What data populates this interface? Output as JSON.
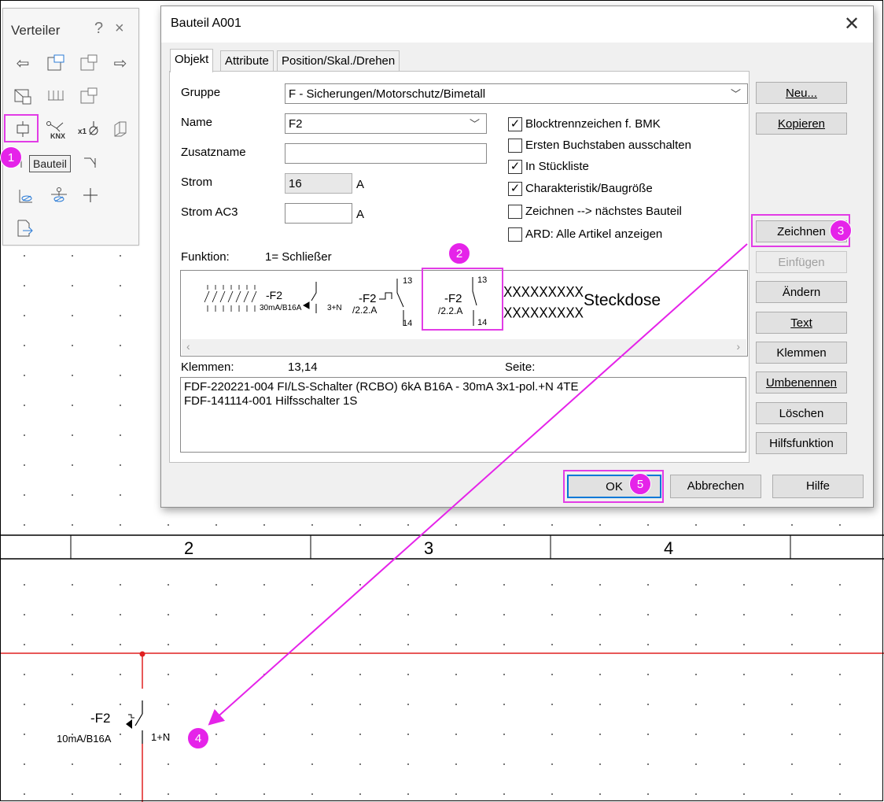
{
  "palette": {
    "title": "Verteiler",
    "help": "?",
    "close": "×",
    "tooltip": "Bauteil",
    "tool_knx_label": "KNX",
    "tool_x1_label": "x1"
  },
  "dialog": {
    "title": "Bauteil A001",
    "tabs": [
      "Objekt",
      "Attribute",
      "Position/Skal./Drehen"
    ],
    "gruppe_label": "Gruppe",
    "gruppe_value": "F - Sicherungen/Motorschutz/Bimetall",
    "name_label": "Name",
    "name_value": "F2",
    "zusatzname_label": "Zusatzname",
    "zusatzname_value": "",
    "strom_label": "Strom",
    "strom_value": "16",
    "strom_unit": "A",
    "stromac3_label": "Strom AC3",
    "stromac3_value": "",
    "stromac3_unit": "A",
    "checkboxes": [
      {
        "label": "Blocktrennzeichen f. BMK",
        "checked": true
      },
      {
        "label": "Ersten Buchstaben ausschalten",
        "checked": false
      },
      {
        "label": "In Stückliste",
        "checked": true
      },
      {
        "label": "Charakteristik/Baugröße",
        "checked": true
      },
      {
        "label": "Zeichnen --> nächstes Bauteil",
        "checked": false
      },
      {
        "label": "ARD: Alle Artikel anzeigen",
        "checked": false
      }
    ],
    "funktion_label": "Funktion:",
    "funktion_value": "1= Schließer",
    "preview": {
      "sym1_label": "-F2",
      "sym1_sub": "30mA/B16A",
      "sym1_pol": "3+N",
      "sym2_label": "-F2",
      "sym2_ref": "/2.2.A",
      "sym2_t1": "13",
      "sym2_t2": "14",
      "sym3_label": "-F2",
      "sym3_ref": "/2.2.A",
      "sym3_t1": "13",
      "sym3_t2": "14",
      "xx1": "XXXXXXXXX",
      "xx2": "XXXXXXXXX",
      "steckdose": "Steckdose"
    },
    "klemmen_label": "Klemmen:",
    "klemmen_value": "13,14",
    "seite_label": "Seite:",
    "articles": [
      "FDF-220221-004  FI/LS-Schalter (RCBO) 6kA  B16A - 30mA  3x1-pol.+N  4TE",
      "FDF-141114-001  Hilfsschalter 1S"
    ],
    "side_buttons": [
      "Neu...",
      "Kopieren",
      "Zeichnen",
      "Einfügen",
      "Ändern",
      "Text",
      "Klemmen",
      "Umbenennen",
      "Löschen",
      "Hilfsfunktion"
    ],
    "ok": "OK",
    "cancel": "Abbrechen",
    "help": "Hilfe"
  },
  "cad": {
    "columns": [
      "2",
      "3",
      "4"
    ],
    "symbol_label": "-F2",
    "symbol_sub": "10mA/B16A",
    "symbol_pol": "1+N"
  },
  "badges": [
    "1",
    "2",
    "3",
    "4",
    "5"
  ],
  "colors": {
    "highlight": "#e523e9",
    "wire": "#e02020",
    "arrow": "#e523e9"
  }
}
